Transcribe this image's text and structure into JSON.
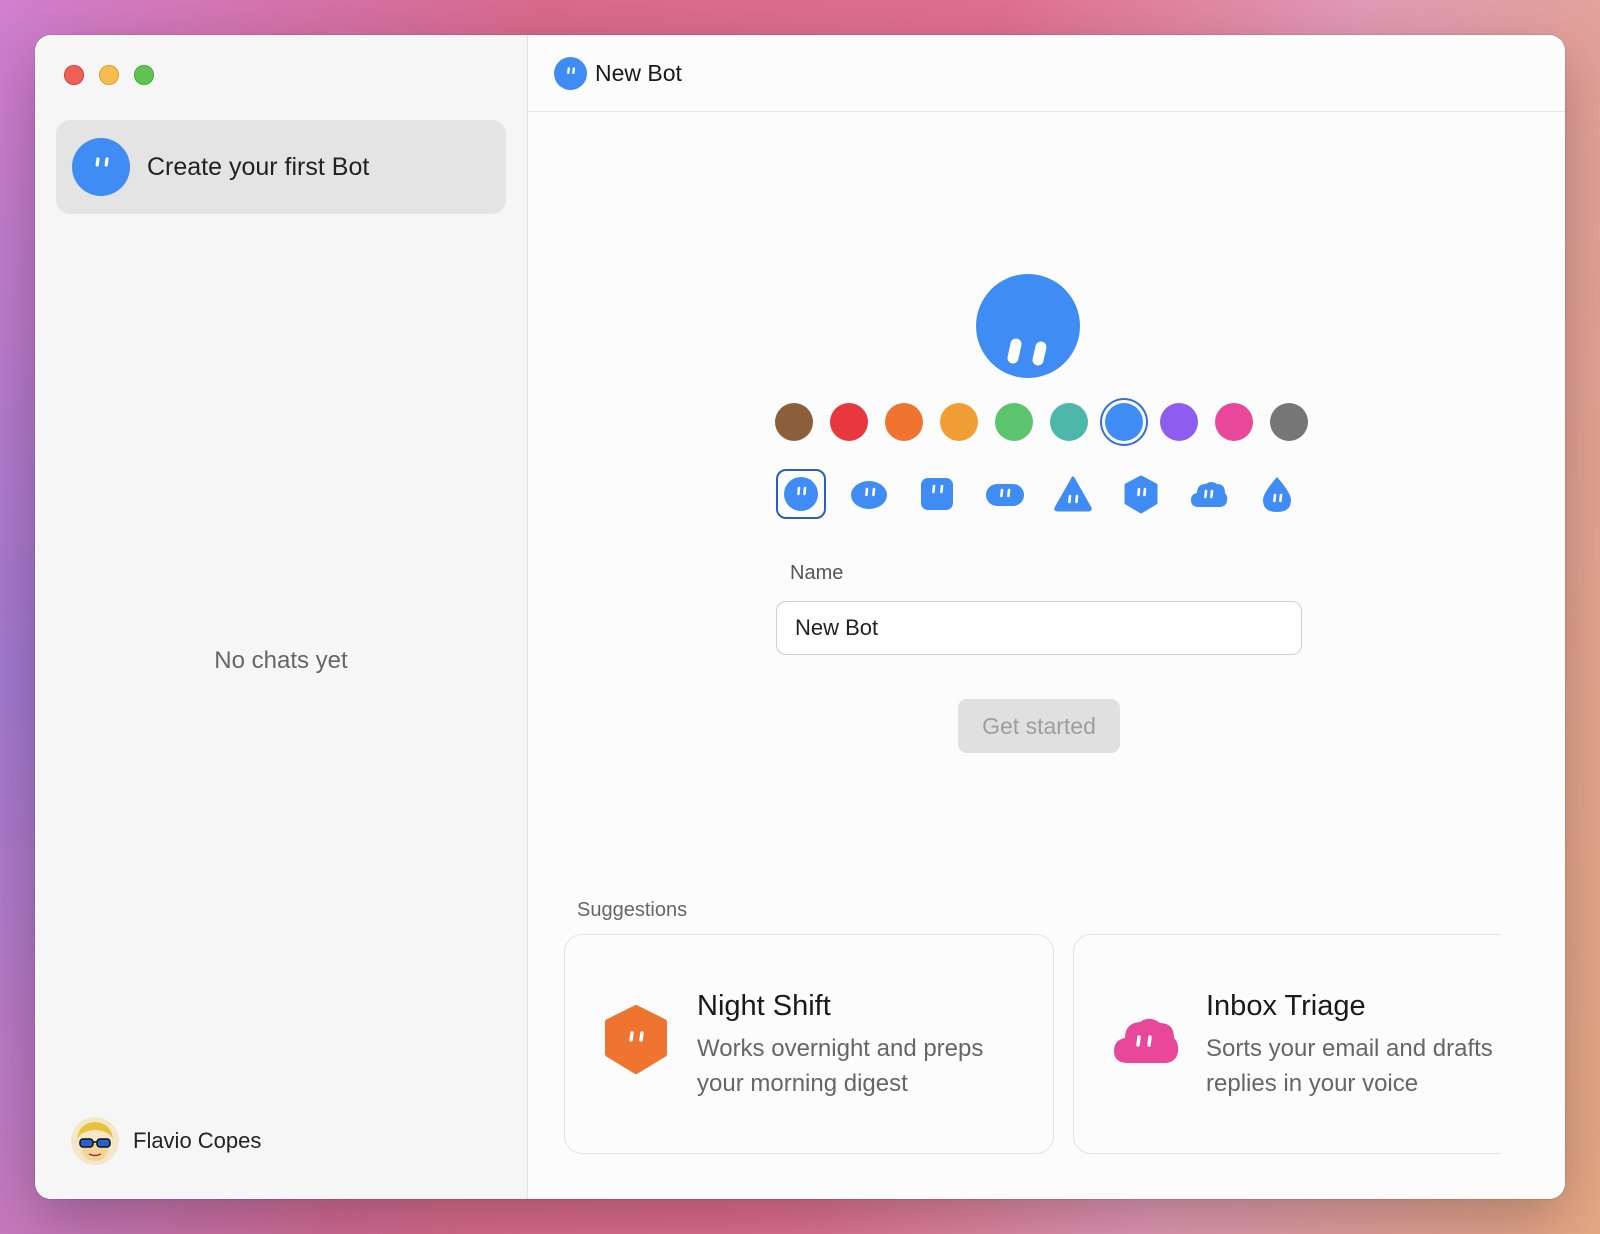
{
  "sidebar": {
    "first_bot_label": "Create your first Bot",
    "empty_text": "No chats yet",
    "user_name": "Flavio Copes"
  },
  "header": {
    "title": "New Bot"
  },
  "editor": {
    "accent_color": "#3f8cf5",
    "selected_color_index": 6,
    "colors": [
      "#8b5e3c",
      "#e8383d",
      "#ee7430",
      "#f19e35",
      "#5bc46f",
      "#4db8a9",
      "#3f8cf5",
      "#8e5df0",
      "#e9489a",
      "#767676"
    ],
    "selected_shape_index": 0,
    "shapes": [
      "circle",
      "blob",
      "square",
      "pill",
      "triangle",
      "hexagon",
      "cloud",
      "drop"
    ],
    "name_label": "Name",
    "name_value": "New Bot",
    "get_started_label": "Get started"
  },
  "suggestions": {
    "label": "Suggestions",
    "items": [
      {
        "title": "Night Shift",
        "desc_line1": "Works overnight and preps",
        "desc_line2": "your morning digest",
        "color": "#ee7430",
        "shape": "hexagon"
      },
      {
        "title": "Inbox Triage",
        "desc_line1": "Sorts your email and drafts",
        "desc_line2": "replies in your voice",
        "color": "#e9489a",
        "shape": "cloud"
      }
    ]
  }
}
